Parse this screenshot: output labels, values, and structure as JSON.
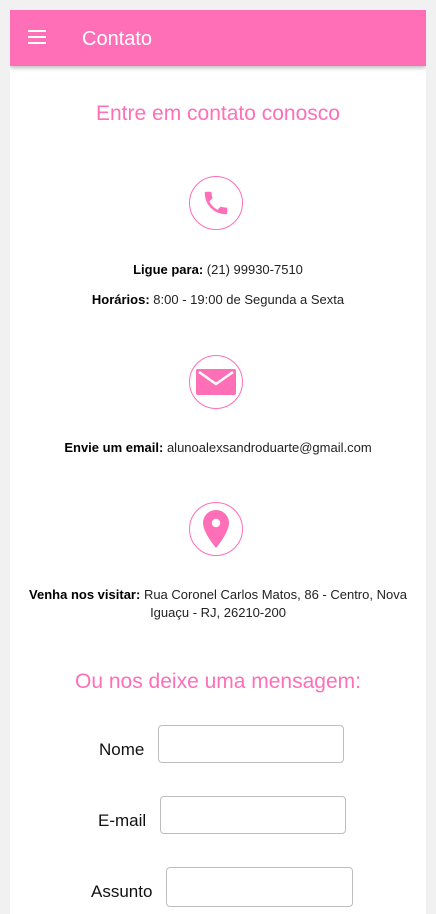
{
  "header": {
    "title": "Contato",
    "menu_icon": "hamburger-menu-icon"
  },
  "heading": "Entre em contato conosco",
  "phone": {
    "icon": "phone-icon",
    "label": "Ligue para:",
    "value": "(21) 99930-7510",
    "hours_label": "Horários:",
    "hours_value": "8:00 - 19:00 de Segunda a Sexta"
  },
  "email": {
    "icon": "mail-icon",
    "label": "Envie um email:",
    "value": "alunoalexsandroduarte@gmail.com"
  },
  "visit": {
    "icon": "location-pin-icon",
    "label": "Venha nos visitar:",
    "value_line1": "Rua Coronel Carlos Matos, 86 - Centro, Nova",
    "value_line2": "Iguaçu - RJ, 26210-200"
  },
  "form": {
    "heading": "Ou nos deixe uma mensagem:",
    "name_label": "Nome",
    "email_label": "E-mail",
    "subject_label": "Assunto",
    "name_value": "",
    "email_value": "",
    "subject_value": ""
  },
  "colors": {
    "accent": "#ff6fb7"
  }
}
